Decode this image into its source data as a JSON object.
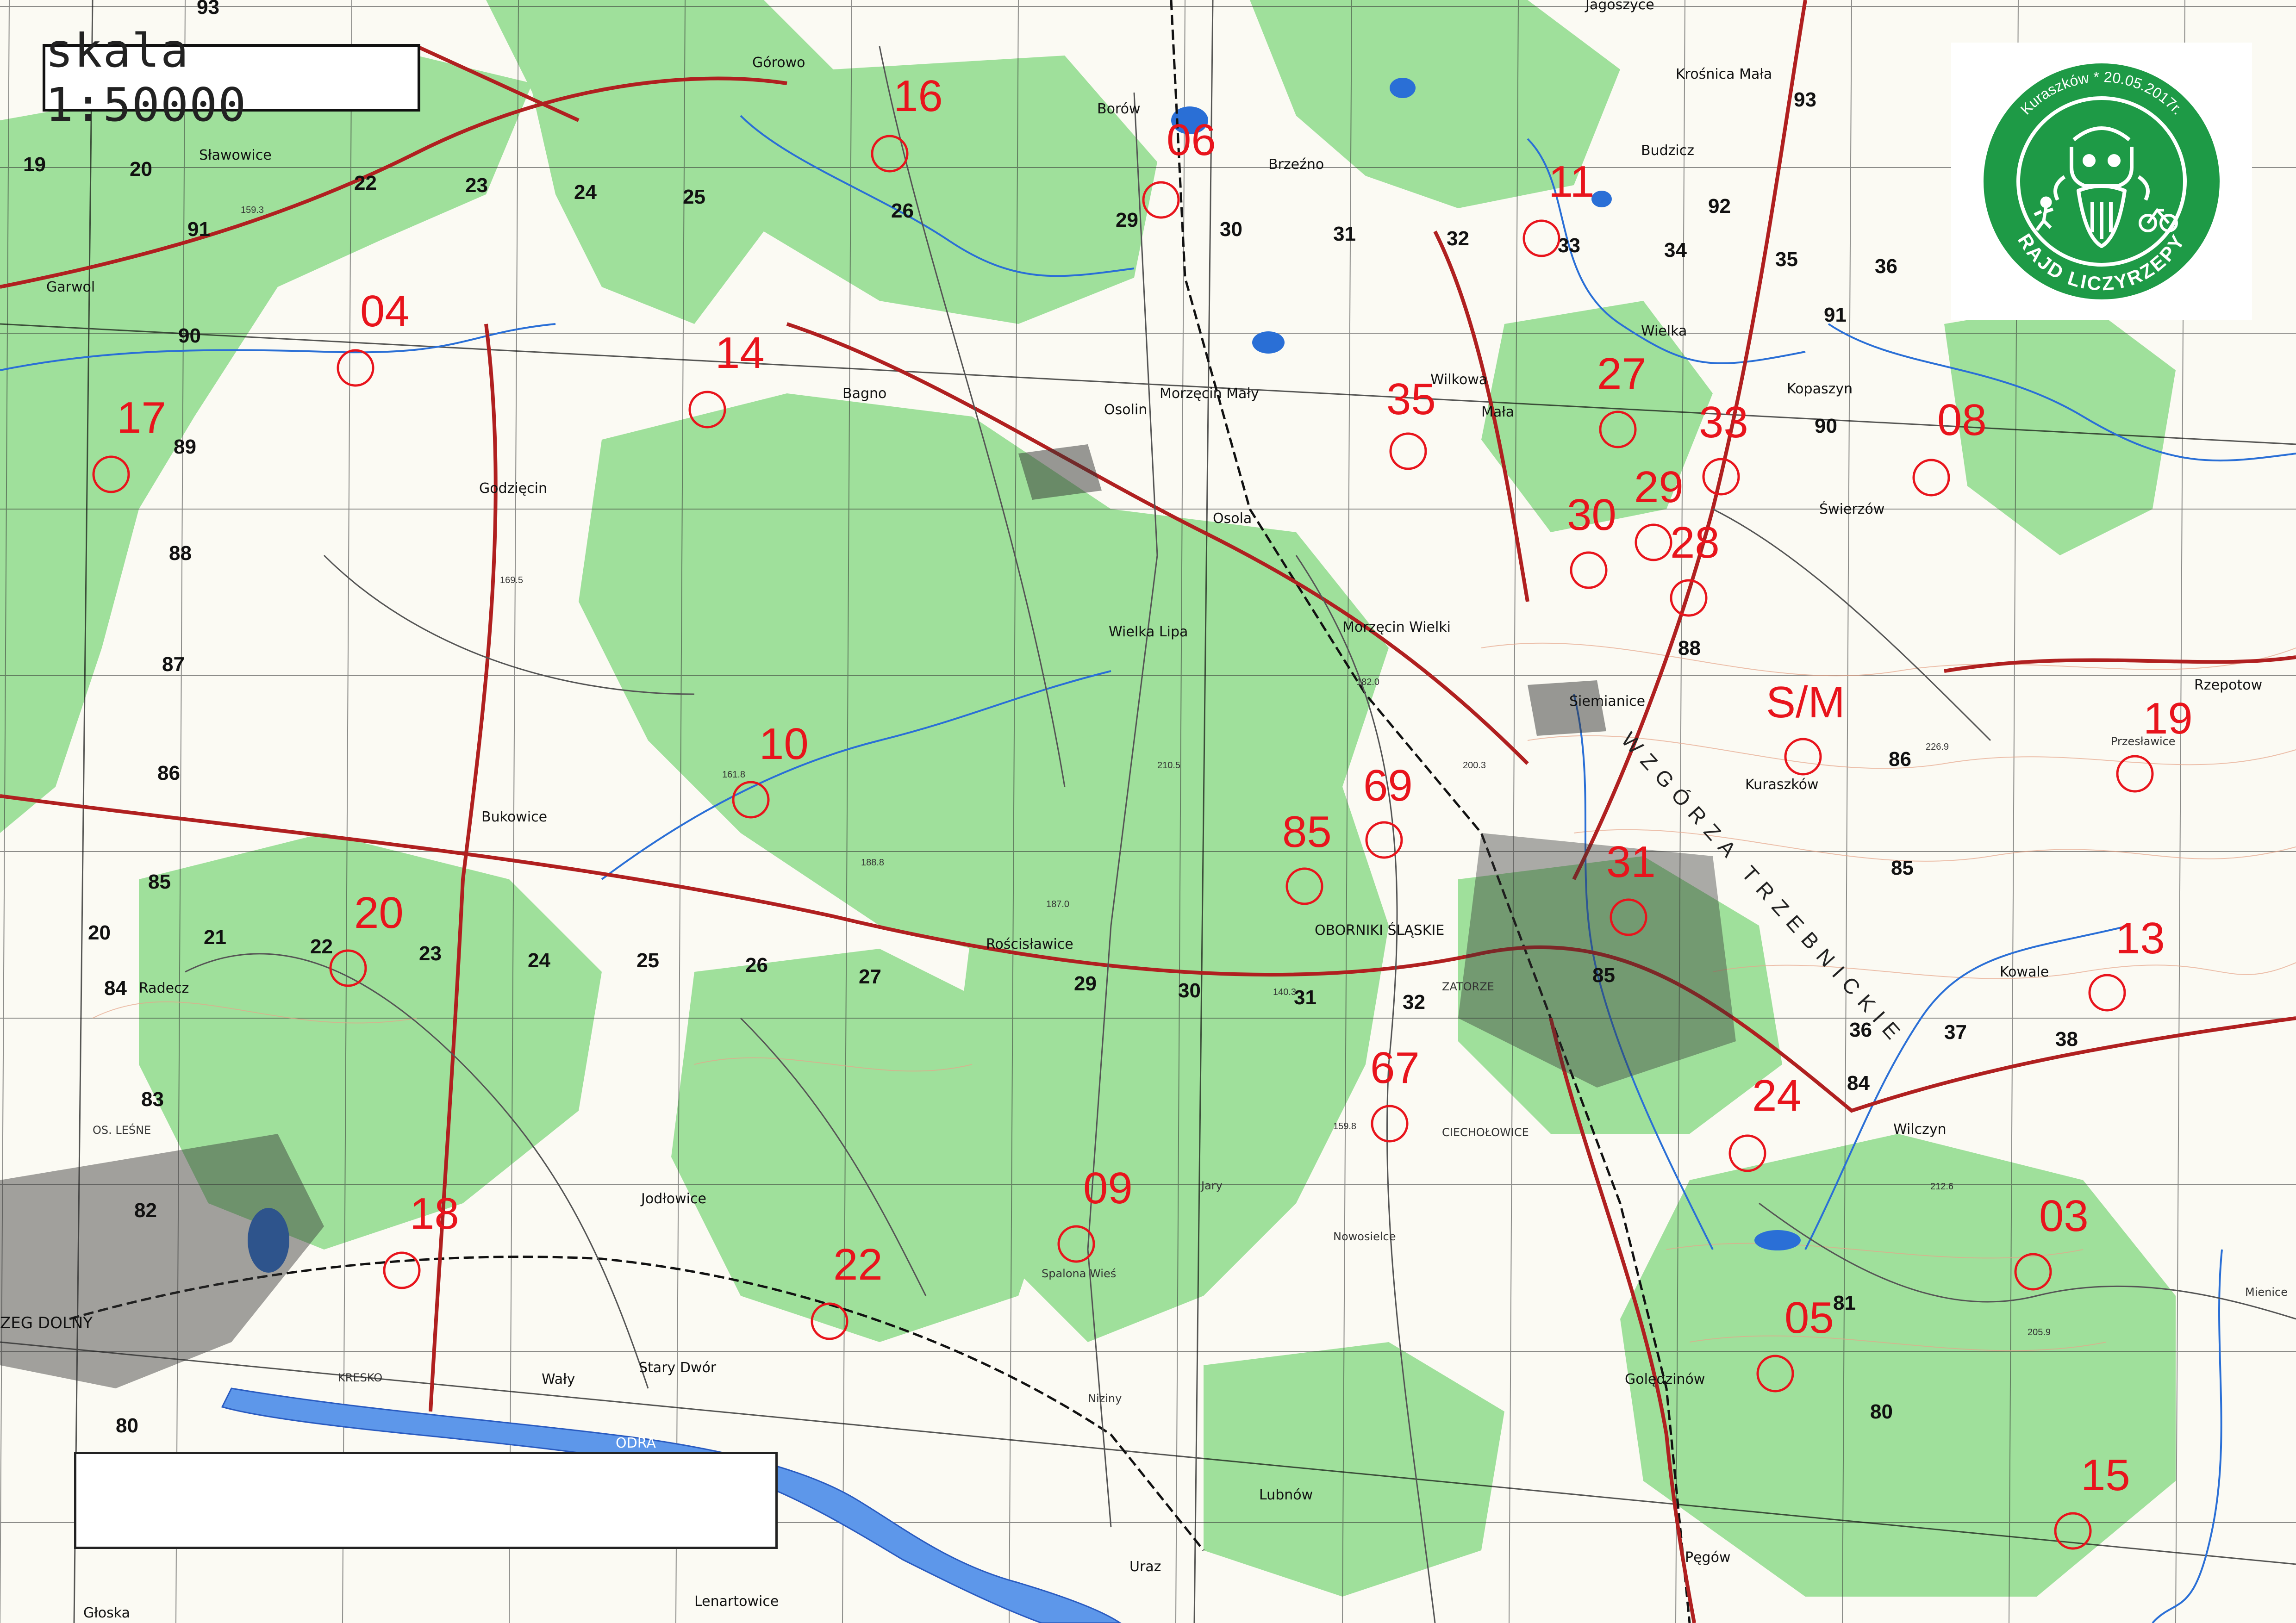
{
  "scale_label": "skala 1:50000",
  "badge": {
    "top_text": "Kuraszków * 20.05.2017r.",
    "bottom_text": "RAJD LICZYRZEPY",
    "color": "#1e9a46"
  },
  "colors": {
    "forest": "#9fe09b",
    "checkpoint": "#e8141c",
    "road_main": "#b02020",
    "water": "#2a6fd6"
  },
  "checkpoints": [
    "16",
    "06",
    "11",
    "04",
    "14",
    "35",
    "27",
    "33",
    "08",
    "17",
    "29",
    "30",
    "28",
    "S/M",
    "19",
    "10",
    "69",
    "85",
    "31",
    "20",
    "13",
    "67",
    "24",
    "09",
    "18",
    "22",
    "03",
    "05",
    "15"
  ],
  "grid_labels": [
    "93",
    "92",
    "91",
    "90",
    "89",
    "88",
    "87",
    "86",
    "85",
    "84",
    "83",
    "82",
    "81",
    "80",
    "19",
    "20",
    "21",
    "22",
    "23",
    "24",
    "25",
    "26",
    "27",
    "29",
    "30",
    "31",
    "32",
    "33",
    "34",
    "35",
    "36",
    "37",
    "38"
  ],
  "ridge_label": "WZGÓRZA TRZEBNICKIE",
  "places": {
    "gorowo": "Górowo",
    "borow": "Borów",
    "brzezno": "Brzeźno",
    "jagoszyce": "Jagoszyce",
    "krosnica": "Krośnica Mała",
    "budzicz": "Budzicz",
    "slawowice": "Sławowice",
    "garwol": "Garwol",
    "osolin": "Osolin",
    "morzecin_maly": "Morzęcin Mały",
    "bagno": "Bagno",
    "wilkowa": "Wilkowa",
    "mala": "Mała",
    "wielka": "Wielka",
    "kopaszyn": "Kopaszyn",
    "swierzow": "Świerzów",
    "godziecin": "Godzięcin",
    "osola": "Osola",
    "morzecin_wielki": "Morzęcin Wielki",
    "wielka_lipa": "Wielka Lipa",
    "siemianice": "Siemianice",
    "kuraszkow": "Kuraszków",
    "przeslawice": "Przesławice",
    "rzepotow": "Rzepotow",
    "bukowice": "Bukowice",
    "oborniki": "OBORNIKI ŚLĄSKIE",
    "zatorze": "ZATORZE",
    "roscislawice": "Rościsławice",
    "radecz": "Radecz",
    "kowale": "Kowale",
    "wilczyn": "Wilczyn",
    "ciecholowice": "CIECHOŁOWICE",
    "jodlowice": "Jodłowice",
    "spalona_wies": "Spalona Wieś",
    "os_lesne": "OS. LEŚNE",
    "brzeg_dolny": "ZEG DOLNY",
    "kresko": "KRESKO",
    "waly": "Wały",
    "stary_dwor": "Stary Dwór",
    "golędzinow": "Golędzinów",
    "lubnow": "Lubnów",
    "uraz": "Uraz",
    "pegow": "Pęgów",
    "lenartowice": "Lenartowice",
    "gloska": "Głoska",
    "mienice": "Mienice",
    "nowosielce": "Nowosielce",
    "niziny": "Niziny",
    "jary": "Jary",
    "odra": "ODRA"
  }
}
